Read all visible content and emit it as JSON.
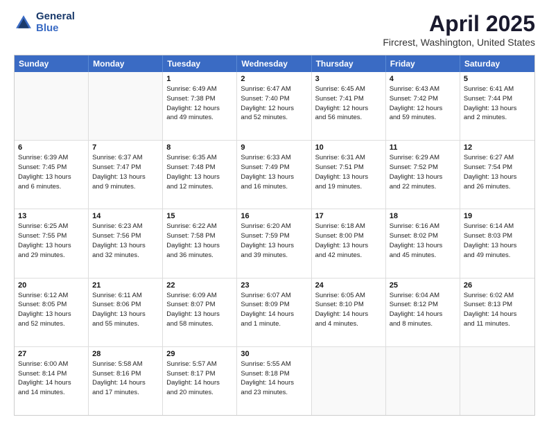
{
  "header": {
    "logo_line1": "General",
    "logo_line2": "Blue",
    "main_title": "April 2025",
    "subtitle": "Fircrest, Washington, United States"
  },
  "calendar": {
    "days": [
      "Sunday",
      "Monday",
      "Tuesday",
      "Wednesday",
      "Thursday",
      "Friday",
      "Saturday"
    ],
    "rows": [
      [
        {
          "day": "",
          "empty": true
        },
        {
          "day": "",
          "empty": true
        },
        {
          "day": "1",
          "lines": [
            "Sunrise: 6:49 AM",
            "Sunset: 7:38 PM",
            "Daylight: 12 hours",
            "and 49 minutes."
          ]
        },
        {
          "day": "2",
          "lines": [
            "Sunrise: 6:47 AM",
            "Sunset: 7:40 PM",
            "Daylight: 12 hours",
            "and 52 minutes."
          ]
        },
        {
          "day": "3",
          "lines": [
            "Sunrise: 6:45 AM",
            "Sunset: 7:41 PM",
            "Daylight: 12 hours",
            "and 56 minutes."
          ]
        },
        {
          "day": "4",
          "lines": [
            "Sunrise: 6:43 AM",
            "Sunset: 7:42 PM",
            "Daylight: 12 hours",
            "and 59 minutes."
          ]
        },
        {
          "day": "5",
          "lines": [
            "Sunrise: 6:41 AM",
            "Sunset: 7:44 PM",
            "Daylight: 13 hours",
            "and 2 minutes."
          ]
        }
      ],
      [
        {
          "day": "6",
          "lines": [
            "Sunrise: 6:39 AM",
            "Sunset: 7:45 PM",
            "Daylight: 13 hours",
            "and 6 minutes."
          ]
        },
        {
          "day": "7",
          "lines": [
            "Sunrise: 6:37 AM",
            "Sunset: 7:47 PM",
            "Daylight: 13 hours",
            "and 9 minutes."
          ]
        },
        {
          "day": "8",
          "lines": [
            "Sunrise: 6:35 AM",
            "Sunset: 7:48 PM",
            "Daylight: 13 hours",
            "and 12 minutes."
          ]
        },
        {
          "day": "9",
          "lines": [
            "Sunrise: 6:33 AM",
            "Sunset: 7:49 PM",
            "Daylight: 13 hours",
            "and 16 minutes."
          ]
        },
        {
          "day": "10",
          "lines": [
            "Sunrise: 6:31 AM",
            "Sunset: 7:51 PM",
            "Daylight: 13 hours",
            "and 19 minutes."
          ]
        },
        {
          "day": "11",
          "lines": [
            "Sunrise: 6:29 AM",
            "Sunset: 7:52 PM",
            "Daylight: 13 hours",
            "and 22 minutes."
          ]
        },
        {
          "day": "12",
          "lines": [
            "Sunrise: 6:27 AM",
            "Sunset: 7:54 PM",
            "Daylight: 13 hours",
            "and 26 minutes."
          ]
        }
      ],
      [
        {
          "day": "13",
          "lines": [
            "Sunrise: 6:25 AM",
            "Sunset: 7:55 PM",
            "Daylight: 13 hours",
            "and 29 minutes."
          ]
        },
        {
          "day": "14",
          "lines": [
            "Sunrise: 6:23 AM",
            "Sunset: 7:56 PM",
            "Daylight: 13 hours",
            "and 32 minutes."
          ]
        },
        {
          "day": "15",
          "lines": [
            "Sunrise: 6:22 AM",
            "Sunset: 7:58 PM",
            "Daylight: 13 hours",
            "and 36 minutes."
          ]
        },
        {
          "day": "16",
          "lines": [
            "Sunrise: 6:20 AM",
            "Sunset: 7:59 PM",
            "Daylight: 13 hours",
            "and 39 minutes."
          ]
        },
        {
          "day": "17",
          "lines": [
            "Sunrise: 6:18 AM",
            "Sunset: 8:00 PM",
            "Daylight: 13 hours",
            "and 42 minutes."
          ]
        },
        {
          "day": "18",
          "lines": [
            "Sunrise: 6:16 AM",
            "Sunset: 8:02 PM",
            "Daylight: 13 hours",
            "and 45 minutes."
          ]
        },
        {
          "day": "19",
          "lines": [
            "Sunrise: 6:14 AM",
            "Sunset: 8:03 PM",
            "Daylight: 13 hours",
            "and 49 minutes."
          ]
        }
      ],
      [
        {
          "day": "20",
          "lines": [
            "Sunrise: 6:12 AM",
            "Sunset: 8:05 PM",
            "Daylight: 13 hours",
            "and 52 minutes."
          ]
        },
        {
          "day": "21",
          "lines": [
            "Sunrise: 6:11 AM",
            "Sunset: 8:06 PM",
            "Daylight: 13 hours",
            "and 55 minutes."
          ]
        },
        {
          "day": "22",
          "lines": [
            "Sunrise: 6:09 AM",
            "Sunset: 8:07 PM",
            "Daylight: 13 hours",
            "and 58 minutes."
          ]
        },
        {
          "day": "23",
          "lines": [
            "Sunrise: 6:07 AM",
            "Sunset: 8:09 PM",
            "Daylight: 14 hours",
            "and 1 minute."
          ]
        },
        {
          "day": "24",
          "lines": [
            "Sunrise: 6:05 AM",
            "Sunset: 8:10 PM",
            "Daylight: 14 hours",
            "and 4 minutes."
          ]
        },
        {
          "day": "25",
          "lines": [
            "Sunrise: 6:04 AM",
            "Sunset: 8:12 PM",
            "Daylight: 14 hours",
            "and 8 minutes."
          ]
        },
        {
          "day": "26",
          "lines": [
            "Sunrise: 6:02 AM",
            "Sunset: 8:13 PM",
            "Daylight: 14 hours",
            "and 11 minutes."
          ]
        }
      ],
      [
        {
          "day": "27",
          "lines": [
            "Sunrise: 6:00 AM",
            "Sunset: 8:14 PM",
            "Daylight: 14 hours",
            "and 14 minutes."
          ]
        },
        {
          "day": "28",
          "lines": [
            "Sunrise: 5:58 AM",
            "Sunset: 8:16 PM",
            "Daylight: 14 hours",
            "and 17 minutes."
          ]
        },
        {
          "day": "29",
          "lines": [
            "Sunrise: 5:57 AM",
            "Sunset: 8:17 PM",
            "Daylight: 14 hours",
            "and 20 minutes."
          ]
        },
        {
          "day": "30",
          "lines": [
            "Sunrise: 5:55 AM",
            "Sunset: 8:18 PM",
            "Daylight: 14 hours",
            "and 23 minutes."
          ]
        },
        {
          "day": "",
          "empty": true
        },
        {
          "day": "",
          "empty": true
        },
        {
          "day": "",
          "empty": true
        }
      ]
    ]
  }
}
